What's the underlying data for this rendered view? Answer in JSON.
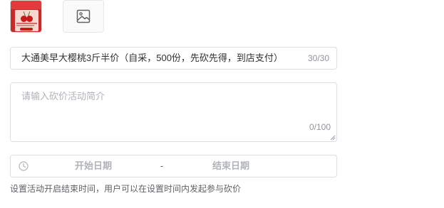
{
  "images": {
    "thumbnail_icon": "cherry-poster-image",
    "upload_icon": "image-upload-icon"
  },
  "title_input": {
    "value": "大通美早大樱桃3斤半价（自采，500份，先砍先得，到店支付）",
    "count": "30/30"
  },
  "description": {
    "placeholder": "请输入砍价活动简介",
    "count": "0/100"
  },
  "date_range": {
    "start_placeholder": "开始日期",
    "separator": "-",
    "end_placeholder": "结束日期",
    "icon": "clock-icon"
  },
  "hint": "设置活动开启结束时间，用户可以在设置时间内发起参与砍价",
  "colors": {
    "border": "#dcdfe6",
    "placeholder": "#b0b3b8",
    "counter": "#909399",
    "poster_red": "#c82a2a"
  }
}
